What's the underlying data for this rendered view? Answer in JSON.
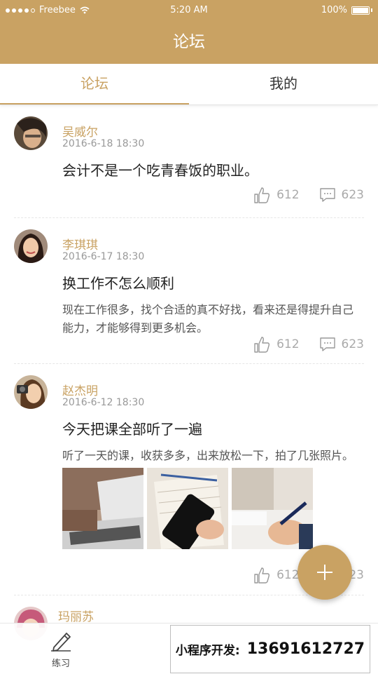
{
  "status_bar": {
    "carrier": "Freebee",
    "time": "5:20 AM",
    "battery": "100%"
  },
  "title": "论坛",
  "tabs": [
    {
      "label": "论坛",
      "active": true
    },
    {
      "label": "我的",
      "active": false
    }
  ],
  "posts": [
    {
      "author": "吴威尔",
      "time": "2016-6-18 18:30",
      "title": "会计不是一个吃青春饭的职业。",
      "body": "",
      "likes": "612",
      "comments": "623"
    },
    {
      "author": "李琪琪",
      "time": "2016-6-17 18:30",
      "title": "换工作不怎么顺利",
      "body": "现在工作很多，找个合适的真不好找，看来还是得提升自己能力，才能够得到更多机会。",
      "likes": "612",
      "comments": "623"
    },
    {
      "author": "赵杰明",
      "time": "2016-6-12 18:30",
      "title": "今天把课全部听了一遍",
      "body": "听了一天的课，收获多多，出来放松一下，拍了几张照片。",
      "likes": "612",
      "comments": "623"
    },
    {
      "author": "玛丽苏"
    }
  ],
  "bottom_nav": {
    "practice_label": "练习"
  },
  "ad": {
    "label": "小程序开发:",
    "phone": "13691612727"
  },
  "colors": {
    "accent": "#c9a263",
    "text": "#222222",
    "muted": "#999999"
  }
}
